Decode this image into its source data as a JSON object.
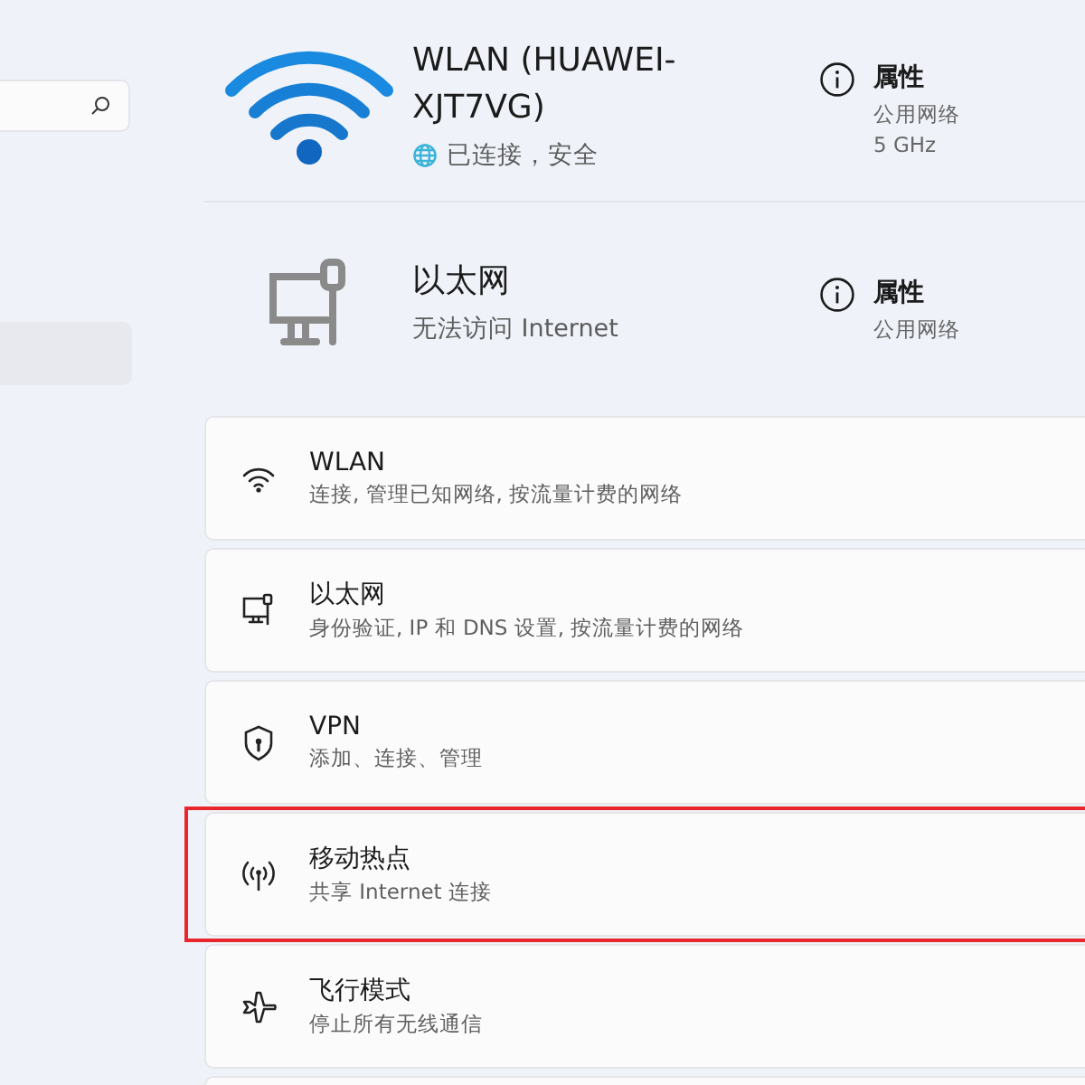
{
  "sidebar": {
    "items": [
      {
        "selected": true
      }
    ]
  },
  "connections": [
    {
      "kind": "wifi",
      "name": "WLAN (HUAWEI-XJT7VG)",
      "status": "已连接，安全",
      "properties": "属性",
      "details": [
        "公用网络",
        "5 GHz"
      ]
    },
    {
      "kind": "ethernet",
      "name": "以太网",
      "status": "无法访问 Internet",
      "properties": "属性",
      "details": [
        "公用网络"
      ]
    }
  ],
  "settings": [
    {
      "kind": "wifi",
      "title": "WLAN",
      "subtitle": "连接, 管理已知网络, 按流量计费的网络",
      "highlighted": false
    },
    {
      "kind": "ethernet",
      "title": "以太网",
      "subtitle": "身份验证, IP 和 DNS 设置, 按流量计费的网络",
      "highlighted": false
    },
    {
      "kind": "vpn",
      "title": "VPN",
      "subtitle": "添加、连接、管理",
      "highlighted": false
    },
    {
      "kind": "hotspot",
      "title": "移动热点",
      "subtitle": "共享 Internet 连接",
      "highlighted": true
    },
    {
      "kind": "airplane",
      "title": "飞行模式",
      "subtitle": "停止所有无线通信",
      "highlighted": false
    }
  ]
}
